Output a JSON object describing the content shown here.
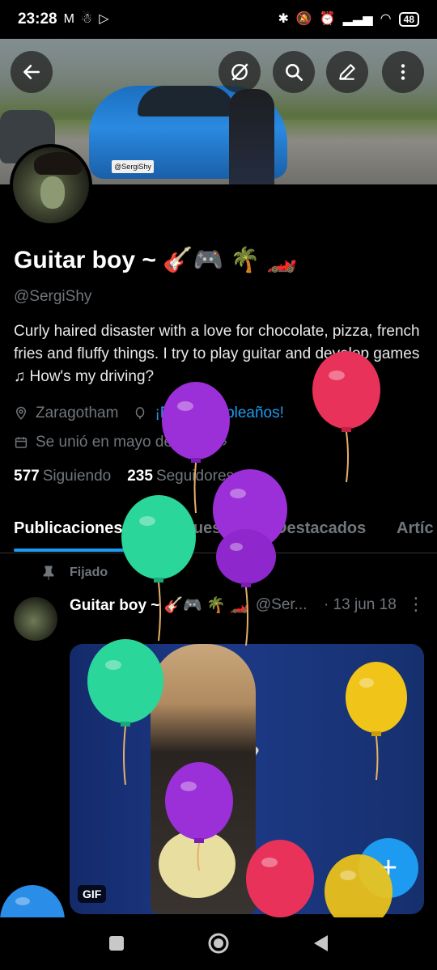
{
  "status_bar": {
    "time": "23:28",
    "battery": "48"
  },
  "profile": {
    "display_name": "Guitar boy ~ 🎸🎮 🌴 🏎️",
    "handle": "@SergiShy",
    "bio": "Curly haired disaster with a love for chocolate, pizza, french fries and fluffy things. I try to play guitar and develop games ♫ How's my driving?",
    "location": "Zaragotham",
    "birthday": "¡Feliz cumpleaños!",
    "joined": "Se unió en mayo de 2013",
    "following_count": "577",
    "following_label": "Siguiendo",
    "followers_count": "235",
    "followers_label": "Seguidores",
    "banner_plate": "@SergiShy"
  },
  "tabs": [
    {
      "label": "Publicaciones",
      "active": true
    },
    {
      "label": "Respuestas",
      "active": false
    },
    {
      "label": "Destacados",
      "active": false
    },
    {
      "label": "Artíc",
      "active": false
    }
  ],
  "pinned_tweet": {
    "pinned_label": "Fijado",
    "author_name": "Guitar boy ~ 🎸🎮 🌴 🏎️",
    "author_handle": "@Ser...",
    "date": "· 13 jun 18",
    "media_badge": "GIF"
  },
  "fab_label": "+",
  "icons": {
    "back": "arrow-left-icon",
    "incognito": "no-circle-icon",
    "search": "search-icon",
    "edit": "pencil-icon",
    "more": "more-vertical-icon",
    "location": "location-pin-icon",
    "balloon": "balloon-icon",
    "calendar": "calendar-icon",
    "pin": "pin-icon"
  },
  "colors": {
    "accent": "#1d9bf0",
    "muted": "#71767b",
    "balloon_red": "#e8325a",
    "balloon_purple": "#9b2fd8",
    "balloon_green": "#2bd69a",
    "balloon_yellow": "#f0c419",
    "balloon_blue": "#2a8de8"
  }
}
